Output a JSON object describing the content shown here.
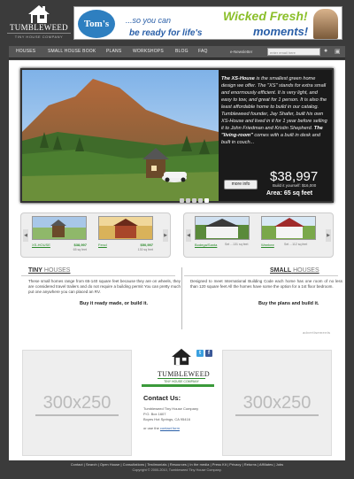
{
  "logo": {
    "title": "TUMBLEWEED",
    "subtitle": "TINY HOUSE COMPANY"
  },
  "banner": {
    "brand": "Tom's",
    "line1": "...so you can",
    "line2": "be ready for life's",
    "headline": "Wicked Fresh!",
    "moments": "moments!"
  },
  "nav": {
    "items": [
      "HOUSES",
      "SMALL HOUSE BOOK",
      "PLANS",
      "WORKSHOPS",
      "BLOG",
      "FAQ"
    ],
    "newsletter": "e-Newsletter",
    "email_placeholder": "enter email here"
  },
  "hero": {
    "lead": "The XS-House",
    "body1": " is the smallest green home design we offer. The \"XS\" stands for extra small and enormously efficient. It is very light, and easy to tow, and great for 1 person. It is also the least affordable home to build in our catalog. Tumbleweed founder, Jay Shafer, built his own XS-House and lived in it for 1 year before selling it to John Friedman and Kristin Shepherd. ",
    "living": "The \"living-room\"",
    "body2": " comes with a built in desk and built in couch...",
    "button": "more info",
    "price": "$38,997",
    "built": "Build it yourself: $16,000",
    "area": "Area: 65 sq feet"
  },
  "gallery_left": [
    {
      "name": "XS-HOUSE",
      "price": "$38,997",
      "area": "65 sq feet"
    },
    {
      "name": "Fencl",
      "price": "$50,997",
      "area": "130 sq feet"
    }
  ],
  "gallery_right": [
    {
      "name": "Bodega/Santa",
      "area": "Set ...131 sq feet"
    },
    {
      "name": "Weebee",
      "area": "Set ...112 sq feet"
    }
  ],
  "tiny": {
    "title_bold": "TINY",
    "title_light": "HOUSES",
    "body": "These small homes range from 65-140 square feet because they are on wheels, they are considered travel trailers and do not require a building permit You can pretty much put one anywhere you can placed an RV.",
    "cta": "Buy it ready made, or build it."
  },
  "small": {
    "title_bold": "SMALL",
    "title_light": "HOUSES",
    "body": "Designed to meet International Building Code each home has one room of no less than 120 square feet All the homes have some the option for a 1st floor bedroom.",
    "cta": "Buy the plans and build it."
  },
  "ads": {
    "label": "advertisements",
    "left": "300x250",
    "right": "300x250"
  },
  "contact": {
    "title": "TUMBLEWEED",
    "subtitle": "TINY HOUSE COMPANY",
    "heading": "Contact Us:",
    "line1": "Tumbleweed Tiny House Company",
    "line2": "P.O. Box 1607",
    "line3": "Boyes Hot Springs, CA 95416",
    "form_prefix": "or use the",
    "form_link": "contact form"
  },
  "footer": {
    "links": "Contact  |  Search  |  Open House  |  Consultations  |  Testimonials  |  Resources  |  In the media  |  Press Kit  |  Privacy  |  Returns  |  Affiliates  |  Jobs",
    "copyright": "Copyright © 2000-2010, Tumbleweed Tiny House Company."
  },
  "colors": {
    "background": "#3b3b3b",
    "accent_green": "#2a8a2a",
    "link_blue": "#2a5fa8"
  }
}
